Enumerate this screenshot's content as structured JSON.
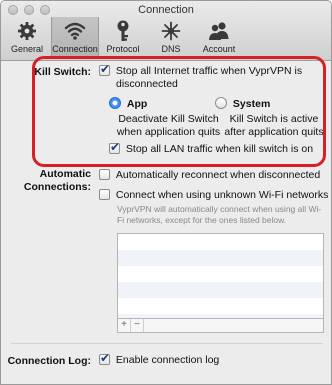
{
  "window": {
    "title": "Connection"
  },
  "toolbar": {
    "items": [
      {
        "label": "General",
        "icon": "gear-icon"
      },
      {
        "label": "Connection",
        "icon": "wifi-icon",
        "selected": true
      },
      {
        "label": "Protocol",
        "icon": "key-icon"
      },
      {
        "label": "DNS",
        "icon": "dns-icon"
      },
      {
        "label": "Account",
        "icon": "account-icon"
      }
    ]
  },
  "kill_switch": {
    "label": "Kill Switch:",
    "stop_internet": {
      "label_line1": "Stop all Internet traffic when VyprVPN is",
      "label_line2": "disconnected",
      "checked": true
    },
    "app": {
      "label": "App",
      "selected": true,
      "desc_line1": "Deactivate Kill Switch",
      "desc_line2": "when application quits"
    },
    "system": {
      "label": "System",
      "selected": false,
      "desc_line1": "Kill Switch is active",
      "desc_line2": "after application quits"
    },
    "stop_lan": {
      "label": "Stop all LAN traffic when kill switch is on",
      "checked": true
    }
  },
  "automatic_connections": {
    "label_line1": "Automatic",
    "label_line2": "Connections:",
    "auto_reconnect": {
      "label": "Automatically reconnect when disconnected",
      "checked": false
    },
    "unknown_wifi": {
      "label": "Connect when using unknown Wi-Fi networks",
      "checked": false
    },
    "note": "VyprVPN will automatically connect when using all Wi-Fi networks, except for the ones listed below.",
    "list_add": "+",
    "list_remove": "−"
  },
  "connection_log": {
    "label": "Connection Log:",
    "enable": {
      "label": "Enable connection log",
      "checked": true
    }
  },
  "colors": {
    "highlight_border": "#d91f26",
    "accent": "#3d8df5"
  }
}
